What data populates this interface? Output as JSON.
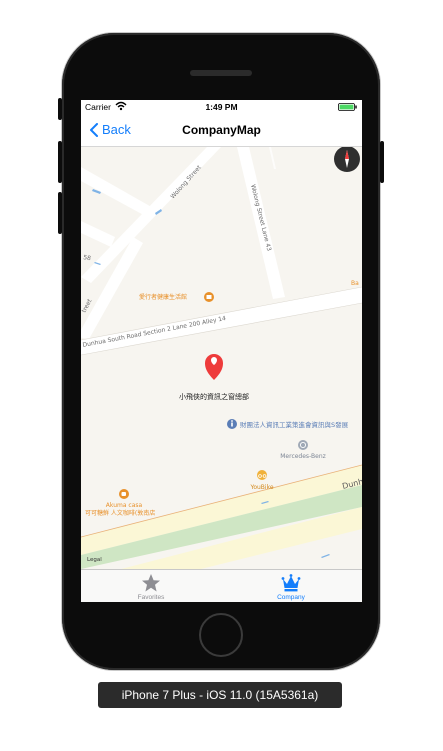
{
  "status_bar": {
    "carrier": "Carrier",
    "time": "1:49 PM"
  },
  "nav": {
    "back_label": "Back",
    "title": "CompanyMap"
  },
  "map": {
    "streets": {
      "wolong_street": "Wolong Street",
      "wolong_street_lane": "Wolong Street Lane 43",
      "dunhua_south_road": "Dunhua South Road Section 2 Lane 200 Alley 14",
      "dunhua_right": "Dunh",
      "street_partial": "treet",
      "street_partial_top": "58",
      "ba_partial": "Ba"
    },
    "pois": {
      "health_shop": "愛行者健康生活館",
      "selected_pin": "小飛俠的資訊之窗總部",
      "institute": "財團法人資訊工業策進會資訊與S發展",
      "mercedes": "Mercedes-Benz",
      "youbike": "YouBike",
      "akuma_casa": "Akuma casa",
      "coffee_shop": "可可糖鮮 人文咖啡(敦南店"
    },
    "legal": "Legal",
    "colors": {
      "pin": "#ee3b3b",
      "poi_orange": "#e8912b",
      "poi_blue": "#5a7db6"
    }
  },
  "tabbar": {
    "tabs": [
      {
        "label": "Favorites",
        "icon": "star-icon",
        "selected": false
      },
      {
        "label": "Company",
        "icon": "crown-icon",
        "selected": true
      }
    ],
    "colors": {
      "selected": "#147efb",
      "unselected": "#8e8e93"
    }
  },
  "caption": "iPhone 7 Plus - iOS 11.0 (15A5361a)"
}
